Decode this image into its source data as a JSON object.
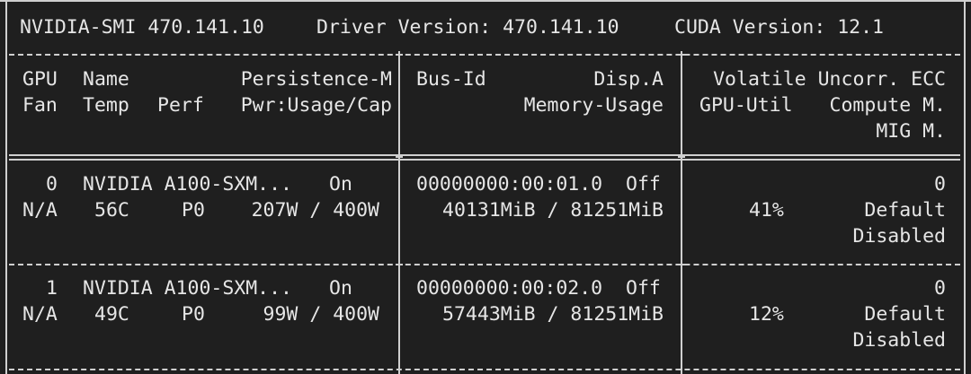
{
  "header": {
    "smi": "NVIDIA-SMI 470.141.10",
    "driver": "Driver Version: 470.141.10",
    "cuda": "CUDA Version: 12.1"
  },
  "columns": {
    "gpu": "GPU",
    "name": "Name",
    "persistence": "Persistence-M",
    "bus_id": "Bus-Id",
    "disp": "Disp.A",
    "volatile": "Volatile Uncorr. ECC",
    "fan": "Fan",
    "temp": "Temp",
    "perf": "Perf",
    "pwr": "Pwr:Usage/Cap",
    "memory_usage": "Memory-Usage",
    "gpu_util": "GPU-Util",
    "compute": "Compute M.",
    "mig": "MIG M."
  },
  "gpus": [
    {
      "index": "0",
      "name": "NVIDIA A100-SXM...",
      "persistence": "On",
      "bus_id": "00000000:00:01.0",
      "disp": "Off",
      "ecc": "0",
      "fan": "N/A",
      "temp": "56C",
      "perf": "P0",
      "power": "207W / 400W",
      "memory": "40131MiB / 81251MiB",
      "util": "41%",
      "compute_mode": "Default",
      "mig_mode": "Disabled"
    },
    {
      "index": "1",
      "name": "NVIDIA A100-SXM...",
      "persistence": "On",
      "bus_id": "00000000:00:02.0",
      "disp": "Off",
      "ecc": "0",
      "fan": "N/A",
      "temp": "49C",
      "perf": "P0",
      "power": "99W / 400W",
      "memory": "57443MiB / 81251MiB",
      "util": "12%",
      "compute_mode": "Default",
      "mig_mode": "Disabled"
    }
  ]
}
